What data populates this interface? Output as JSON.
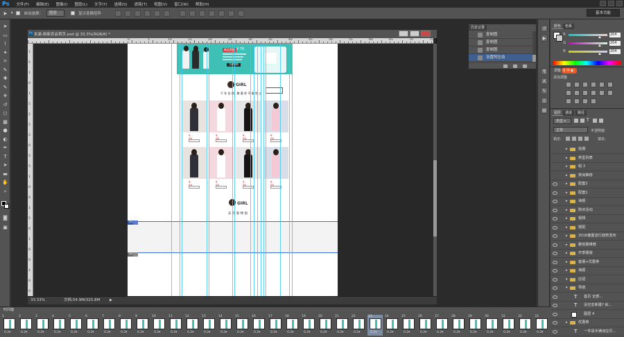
{
  "app": {
    "logo": "Ps"
  },
  "menu": [
    "文件(F)",
    "编辑(E)",
    "图像(I)",
    "图层(L)",
    "文字(Y)",
    "选择(S)",
    "滤镜(T)",
    "视图(V)",
    "窗口(W)",
    "帮助(H)"
  ],
  "options_bar": {
    "auto_select_label": "自动选择：",
    "auto_select_value": "图层",
    "show_transform_label": "显示变换控件"
  },
  "workspace_label": "基本功能",
  "document": {
    "tab_title": "女装-新新农会首页.psd @ 33.3%(RGB/8) *",
    "zoom": "33.33%",
    "doc_size": "文档:54.9M/325.8M",
    "ruler_h": [
      "0",
      "5",
      "10",
      "15",
      "20",
      "25",
      "30",
      "35",
      "40",
      "45",
      "50",
      "55",
      "60",
      "65",
      "70",
      "75",
      "80",
      "85",
      "90",
      "95",
      "100"
    ],
    "ruler_v": [
      "1",
      "5",
      "1",
      "0",
      "1",
      "5",
      "2",
      "5",
      "5",
      "0",
      "5",
      "5",
      "1",
      "0",
      "0",
      "1",
      "5",
      "0",
      "1",
      "8",
      "0",
      "2",
      "0",
      "0"
    ],
    "banner": {
      "tag": "新品首发",
      "price": "¥ 76",
      "cta": "立即抢购"
    },
    "logo_text": "GIRL",
    "tagline": "千 年 佳 期 , 聚 惠 你 不 能 错 过",
    "tagline2": "天 然 新 特 别",
    "price_labels": [
      "¥ 99",
      "¥ 99",
      "¥ 99",
      "¥ 99",
      "¥ 99",
      "¥ 99",
      "¥ 99",
      "¥ 99"
    ],
    "slice_labels": [
      "01",
      "02"
    ]
  },
  "history_panel": {
    "tabs": [
      "历史记录"
    ],
    "rows": [
      "复制图",
      "复制图",
      "复制图",
      "设置阿拉伯"
    ]
  },
  "color_panel": {
    "tabs": [
      "颜色",
      "色板"
    ],
    "channels": [
      {
        "name": "R",
        "value": "204"
      },
      {
        "name": "G",
        "value": "204"
      },
      {
        "name": "B",
        "value": "204"
      }
    ],
    "swatch": "#cccccc"
  },
  "adjustments_panel": {
    "tabs": [
      "调整"
    ],
    "title": "添加调整"
  },
  "layers_panel": {
    "tabs": [
      "图层",
      "通道",
      "路径"
    ],
    "filter": "类型",
    "blend": "正常",
    "opacity_label": "不透明度:",
    "lock_label": "锁定:",
    "fill_label": "填充:",
    "layers": [
      {
        "name": "拍摄",
        "type": "group",
        "visible": false
      },
      {
        "name": "类型列表",
        "type": "group",
        "visible": false
      },
      {
        "name": "组 2",
        "type": "group",
        "visible": false
      },
      {
        "name": "类目推荐",
        "type": "group",
        "visible": false
      },
      {
        "name": "配套2",
        "type": "group",
        "visible": true
      },
      {
        "name": "配套1",
        "type": "group",
        "visible": true
      },
      {
        "name": "海报",
        "type": "group",
        "visible": true
      },
      {
        "name": "购买活动",
        "type": "group",
        "visible": true
      },
      {
        "name": "视频",
        "type": "group",
        "visible": true
      },
      {
        "name": "搭配",
        "type": "group",
        "visible": true
      },
      {
        "name": "2016春夏流行趋势发布",
        "type": "group",
        "visible": true
      },
      {
        "name": "聚划算推荐",
        "type": "group",
        "visible": true
      },
      {
        "name": "开季服装",
        "type": "group",
        "visible": true
      },
      {
        "name": "客服+优惠券",
        "type": "group",
        "visible": true
      },
      {
        "name": "海报",
        "type": "group",
        "visible": true
      },
      {
        "name": "店招",
        "type": "group",
        "visible": true
      },
      {
        "name": "导航",
        "type": "group",
        "visible": true
      },
      {
        "name": "首页        全部...",
        "type": "text",
        "visible": true
      },
      {
        "name": "没空去新疆? 就...",
        "type": "text",
        "visible": true
      },
      {
        "name": "图层 4",
        "type": "pixel",
        "visible": true
      },
      {
        "name": "优惠券",
        "type": "group",
        "visible": true
      },
      {
        "name": "一件请手满洲宝贝...",
        "type": "text",
        "visible": true
      }
    ]
  },
  "timeline": {
    "title": "时间轴",
    "frames": [
      "1",
      "2",
      "3",
      "4",
      "5",
      "6",
      "7",
      "8",
      "9",
      "10",
      "11",
      "12",
      "13",
      "14",
      "15",
      "16",
      "17",
      "18",
      "19",
      "20",
      "21",
      "22",
      "23",
      "24",
      "25",
      "26",
      "27",
      "28",
      "29",
      "30",
      "31",
      "32",
      "33"
    ],
    "delay": "0.2",
    "selected_frame": "23"
  }
}
